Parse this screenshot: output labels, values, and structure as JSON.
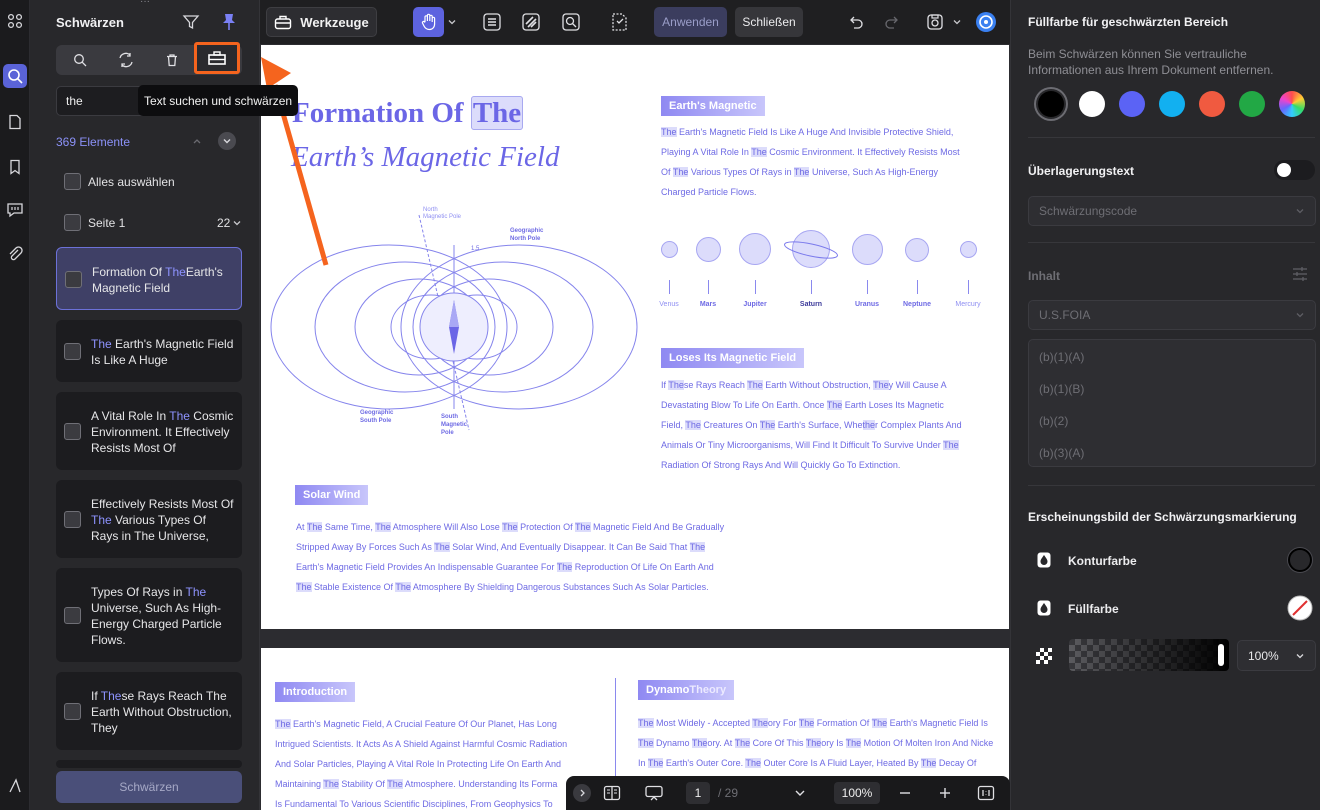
{
  "left_panel": {
    "title": "Schwärzen",
    "search_value": "the",
    "tooltip": "Text suchen und schwärzen",
    "count": "369 Elemente",
    "select_all": "Alles auswählen",
    "page_label": "Seite 1",
    "page_count": "22",
    "results": [
      {
        "pre": "Formation Of ",
        "hl": "The",
        "post": "Earth's Magnetic Field"
      },
      {
        "pre": "",
        "hl": "The",
        "post": " Earth's Magnetic Field Is Like A Huge"
      },
      {
        "pre": "A Vital Role In ",
        "hl": "The",
        "post": " Cosmic Environment. It Effectively Resists Most Of"
      },
      {
        "pre": "Effectively Resists Most Of ",
        "hl": "The",
        "post": " Various Types Of Rays in The Universe,"
      },
      {
        "pre": "Types Of Rays in ",
        "hl": "The",
        "post": " Universe, Such As High-Energy Charged Particle Flows."
      },
      {
        "pre": "If ",
        "hl": "The",
        "post": "se Rays Reach The Earth Without Obstruction, They"
      }
    ],
    "apply_button": "Schwärzen"
  },
  "toolbar": {
    "tools_label": "Werkzeuge",
    "apply": "Anwenden",
    "close": "Schließen"
  },
  "document": {
    "title_pre": "Formation Of ",
    "title_mark": "The",
    "subtitle": "Earth’s Magnetic Field",
    "diagram_labels": {
      "north_magnetic": "North Magnetic Pole",
      "geographic_north": "Geographic North Pole",
      "geographic_south": "Geographic South Pole",
      "south_magnetic": "South Magnetic Pole",
      "angle": "1.5"
    },
    "section_earth": "Earth's Magnetic",
    "earth_lines": [
      [
        "",
        "The",
        " Earth's Magnetic Field Is Like A Huge And Invisible Protective Shield,"
      ],
      [
        "Playing A Vital Role In ",
        "The",
        " Cosmic Environment. It Effectively Resists Most"
      ],
      [
        "Of ",
        "The",
        " Various Types Of Rays in ",
        "The",
        " Universe, Such As High-Energy"
      ],
      [
        "Charged Particle Flows."
      ]
    ],
    "planets": [
      "Venus",
      "Mars",
      "Jupiter",
      "Saturn",
      "Uranus",
      "Neptune",
      "Mercury"
    ],
    "section_loses": "Loses Its Magnetic Field",
    "loses_lines": [
      [
        "If ",
        "The",
        "se Rays Reach ",
        "The",
        " Earth Without Obstruction, ",
        "The",
        "y Will Cause A"
      ],
      [
        "Devastating Blow To Life On Earth. Once ",
        "The",
        " Earth Loses Its Magnetic"
      ],
      [
        "Field, ",
        "The",
        " Creatures On ",
        "The",
        " Earth's Surface, Whe",
        "the",
        "r Complex Plants And"
      ],
      [
        "Animals Or Tiny Microorganisms, Will Find It Difficult To Survive Under ",
        "The"
      ],
      [
        "Radiation Of Strong Rays And Will Quickly Go To Extinction."
      ]
    ],
    "section_solar": "Solar Wind",
    "solar_lines": [
      [
        "At ",
        "The",
        " Same Time, ",
        "The",
        " Atmosphere Will Also Lose ",
        "The",
        " Protection Of ",
        "The",
        " Magnetic Field And Be Gradually"
      ],
      [
        "Stripped Away By Forces Such As ",
        "The",
        " Solar Wind, And Eventually Disappear. It Can Be Said That ",
        "The"
      ],
      [
        "Earth's Magnetic Field Provides An Indispensable Guarantee For ",
        "The",
        " Reproduction Of Life On Earth And"
      ],
      [
        "",
        "The",
        " Stable Existence Of ",
        "The",
        " Atmosphere By Shielding Dangerous Substances Such As Solar Particles."
      ]
    ],
    "section_intro": "Introduction",
    "intro_lines": [
      [
        "",
        "The",
        " Earth's Magnetic Field, A Crucial Feature Of Our Planet, Has Long"
      ],
      [
        "Intrigued Scientists. It Acts As A Shield Against Harmful Cosmic Radiation"
      ],
      [
        "And Solar Particles, Playing A Vital Role In Protecting Life On Earth And"
      ],
      [
        "Maintaining ",
        "The",
        " Stability Of ",
        "The",
        " Atmosphere. Understanding Its Forma"
      ],
      [
        "Is Fundamental To Various Scientific Disciplines, From Geophysics To"
      ]
    ],
    "section_dynamo_pre": "Dynamo ",
    "section_dynamo_hl": "Theory",
    "dynamo_lines": [
      [
        "",
        "The",
        " Most Widely - Accepted ",
        "The",
        "ory For ",
        "The",
        " Formation Of ",
        "The",
        " Earth's Magnetic Field Is"
      ],
      [
        "",
        "The",
        " Dynamo ",
        "The",
        "ory. At ",
        "The",
        " Core Of This ",
        "The",
        "ory Is ",
        "The",
        " Motion Of Molten Iron And Nicke"
      ],
      [
        "In ",
        "The",
        " Earth's Outer Core. ",
        "The",
        " Outer Core Is A Fluid Layer, Heated By ",
        "The",
        " Decay Of"
      ]
    ]
  },
  "bottom_bar": {
    "page": "1",
    "total": "/ 29",
    "zoom": "100%"
  },
  "right_panel": {
    "fill_title": "Füllfarbe für geschwärzten Bereich",
    "fill_desc": "Beim Schwärzen können Sie vertrauliche Informationen aus Ihrem Dokument entfernen.",
    "colors": [
      "#000000",
      "#ffffff",
      "#5b63f5",
      "#12b0f0",
      "#f05a40",
      "#22a845"
    ],
    "overlay_title": "Überlagerungstext",
    "overlay_select": "Schwärzungscode",
    "content_label": "Inhalt",
    "content_select": "U.S.FOIA",
    "codes": [
      "(b)(1)(A)",
      "(b)(1)(B)",
      "(b)(2)",
      "(b)(3)(A)"
    ],
    "appearance_title": "Erscheinungsbild der Schwärzungsmarkierung",
    "outline_label": "Konturfarbe",
    "fill_label": "Füllfarbe",
    "opacity": "100%"
  }
}
